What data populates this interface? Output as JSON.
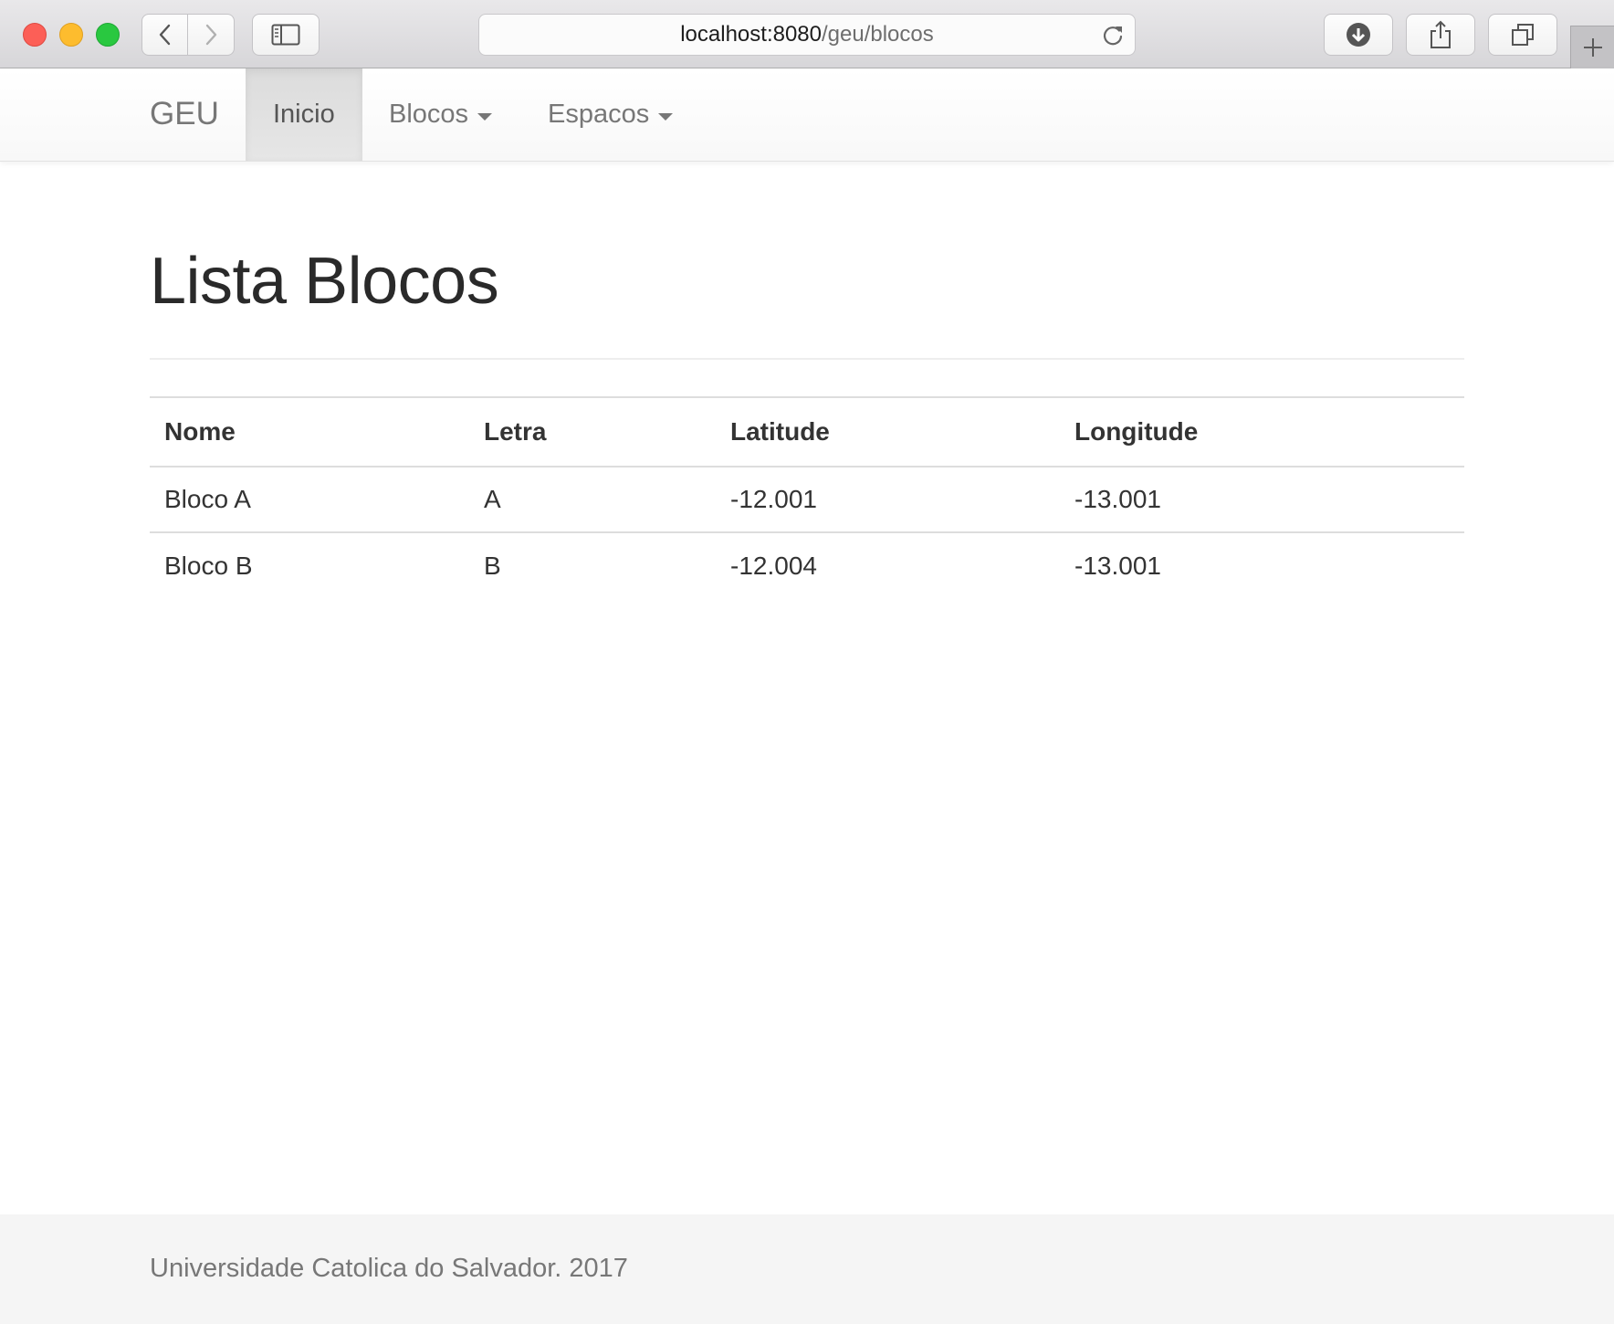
{
  "browser": {
    "url_host": "localhost:8080",
    "url_path": "/geu/blocos",
    "icons": {
      "back": "chevron-left-icon",
      "forward": "chevron-right-icon",
      "sidebar": "sidebar-icon",
      "reload": "reload-icon",
      "download": "download-icon",
      "share": "share-icon",
      "tabs": "tabs-icon",
      "new_tab": "plus-icon"
    }
  },
  "navbar": {
    "brand": "GEU",
    "items": [
      {
        "label": "Inicio",
        "active": true
      },
      {
        "label": "Blocos",
        "dropdown": true
      },
      {
        "label": "Espacos",
        "dropdown": true
      }
    ]
  },
  "main": {
    "title": "Lista Blocos",
    "table": {
      "headers": [
        "Nome",
        "Letra",
        "Latitude",
        "Longitude"
      ],
      "rows": [
        [
          "Bloco A",
          "A",
          "-12.001",
          "-13.001"
        ],
        [
          "Bloco B",
          "B",
          "-12.004",
          "-13.001"
        ]
      ]
    }
  },
  "footer": {
    "text": "Universidade Catolica do Salvador. 2017"
  }
}
